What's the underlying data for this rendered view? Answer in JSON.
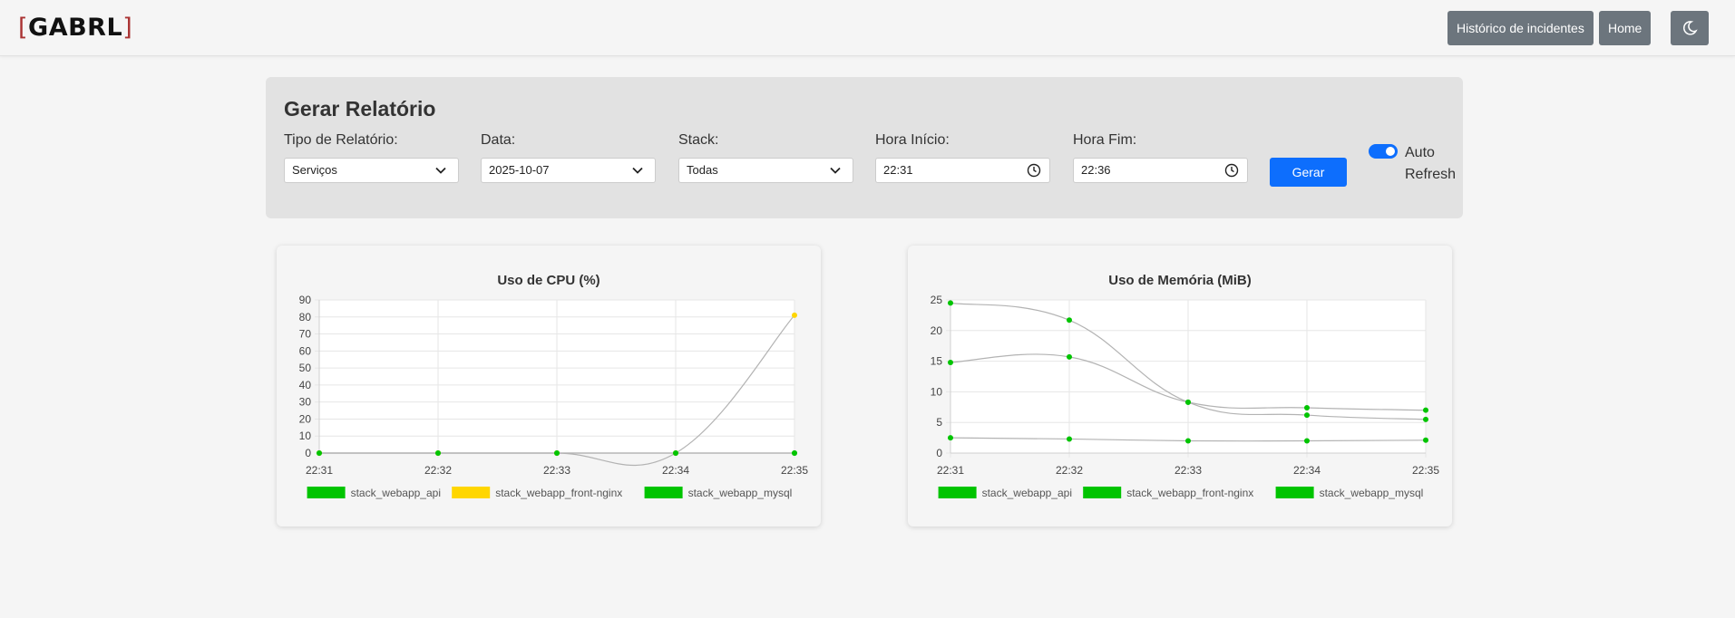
{
  "header": {
    "logo": "GABRL",
    "nav": {
      "history_label": "Histórico de incidentes",
      "home_label": "Home"
    },
    "theme_icon": "moon-icon"
  },
  "report": {
    "title": "Gerar Relatório",
    "fields": {
      "type": {
        "label": "Tipo de Relatório:",
        "value": "Serviços"
      },
      "date": {
        "label": "Data:",
        "value": "2025-10-07"
      },
      "stack": {
        "label": "Stack:",
        "value": "Todas"
      },
      "start": {
        "label": "Hora Início:",
        "value": "22:31"
      },
      "end": {
        "label": "Hora Fim:",
        "value": "22:36"
      }
    },
    "generate_label": "Gerar",
    "auto_refresh": {
      "label": "Auto Refresh",
      "enabled": true
    }
  },
  "chart_data": [
    {
      "type": "line",
      "title": "Uso de CPU (%)",
      "x": [
        "22:31",
        "22:32",
        "22:33",
        "22:34",
        "22:35"
      ],
      "ylim": [
        0,
        90
      ],
      "yticks": [
        0,
        10,
        20,
        30,
        40,
        50,
        60,
        70,
        80,
        90
      ],
      "grid": true,
      "legend": "bottom",
      "series": [
        {
          "name": "stack_webapp_api",
          "color": "#00c400",
          "values": [
            0,
            0,
            0,
            0,
            0
          ]
        },
        {
          "name": "stack_webapp_front-nginx",
          "color": "#ffd600",
          "values": [
            0,
            0,
            0,
            0,
            81
          ]
        },
        {
          "name": "stack_webapp_mysql",
          "color": "#00c400",
          "values": [
            0,
            0,
            0,
            0,
            0
          ]
        }
      ]
    },
    {
      "type": "line",
      "title": "Uso de Memória (MiB)",
      "x": [
        "22:31",
        "22:32",
        "22:33",
        "22:34",
        "22:35"
      ],
      "ylim": [
        0,
        25
      ],
      "yticks": [
        0,
        5,
        10,
        15,
        20,
        25
      ],
      "grid": true,
      "legend": "bottom",
      "series": [
        {
          "name": "stack_webapp_api",
          "color": "#00c400",
          "values": [
            24.5,
            21.7,
            8.3,
            6.2,
            5.5
          ]
        },
        {
          "name": "stack_webapp_front-nginx",
          "color": "#00c400",
          "values": [
            2.5,
            2.3,
            2.0,
            2.0,
            2.1
          ]
        },
        {
          "name": "stack_webapp_mysql",
          "color": "#00c400",
          "values": [
            14.8,
            15.7,
            8.3,
            7.4,
            7.0
          ]
        }
      ]
    }
  ]
}
